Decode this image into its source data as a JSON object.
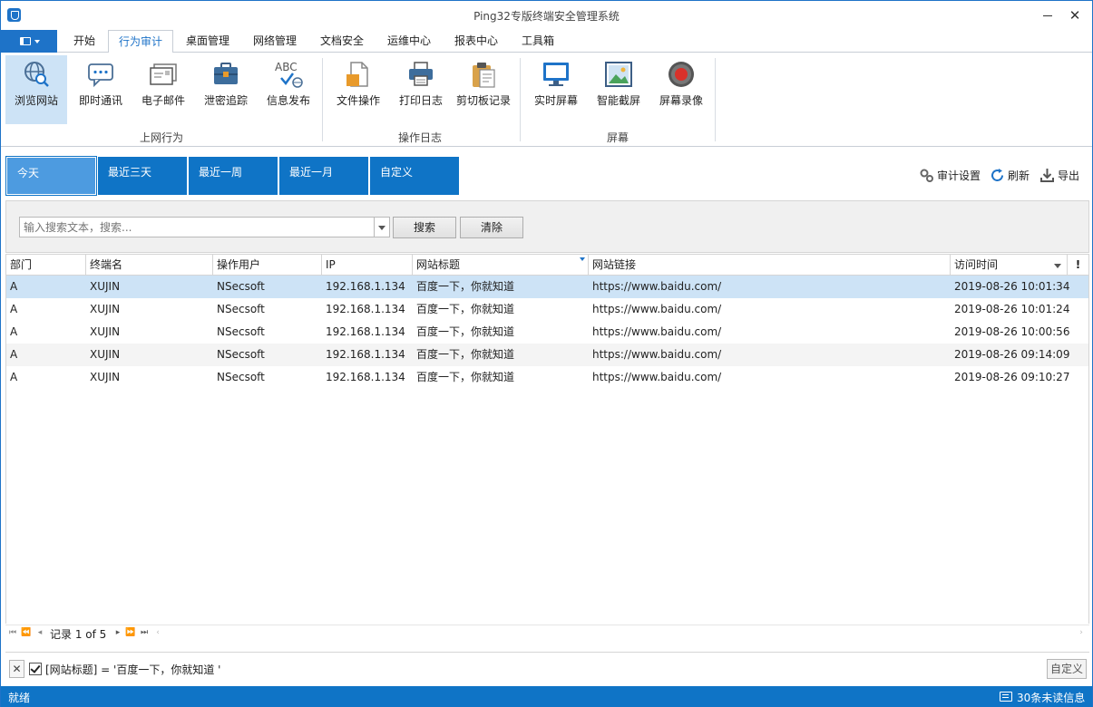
{
  "app": {
    "title": "Ping32专版终端安全管理系统"
  },
  "tabs": [
    {
      "label": "开始"
    },
    {
      "label": "行为审计"
    },
    {
      "label": "桌面管理"
    },
    {
      "label": "网络管理"
    },
    {
      "label": "文档安全"
    },
    {
      "label": "运维中心"
    },
    {
      "label": "报表中心"
    },
    {
      "label": "工具箱"
    }
  ],
  "active_tab": "行为审计",
  "ribbon": {
    "groups": [
      {
        "label": "上网行为"
      },
      {
        "label": "操作日志"
      },
      {
        "label": "屏幕"
      }
    ],
    "buttons": [
      {
        "label": "浏览网站",
        "icon": "globe-search-icon"
      },
      {
        "label": "即时通讯",
        "icon": "chat-bubble-icon"
      },
      {
        "label": "电子邮件",
        "icon": "email-icon"
      },
      {
        "label": "泄密追踪",
        "icon": "briefcase-icon"
      },
      {
        "label": "信息发布",
        "icon": "abc-publish-icon",
        "icon_text": "ABC"
      },
      {
        "label": "文件操作",
        "icon": "file-icon"
      },
      {
        "label": "打印日志",
        "icon": "printer-icon"
      },
      {
        "label": "剪切板记录",
        "icon": "clipboard-icon"
      },
      {
        "label": "实时屏幕",
        "icon": "monitor-icon"
      },
      {
        "label": "智能截屏",
        "icon": "screenshot-image-icon"
      },
      {
        "label": "屏幕录像",
        "icon": "record-icon"
      }
    ]
  },
  "date_tabs": [
    {
      "label": "今天"
    },
    {
      "label": "最近三天"
    },
    {
      "label": "最近一周"
    },
    {
      "label": "最近一月"
    },
    {
      "label": "自定义"
    }
  ],
  "toolbar_right": {
    "audit_settings": "审计设置",
    "refresh": "刷新",
    "export": "导出"
  },
  "search": {
    "placeholder": "输入搜索文本，搜索...",
    "search_button": "搜索",
    "clear_button": "清除"
  },
  "grid": {
    "columns": [
      "部门",
      "终端名",
      "操作用户",
      "IP",
      "网站标题",
      "网站链接",
      "访问时间"
    ],
    "rows": [
      [
        "A",
        "XUJIN",
        "NSecsoft",
        "192.168.1.134",
        "百度一下，你就知道",
        "https://www.baidu.com/",
        "2019-08-26 10:01:34"
      ],
      [
        "A",
        "XUJIN",
        "NSecsoft",
        "192.168.1.134",
        "百度一下，你就知道",
        "https://www.baidu.com/",
        "2019-08-26 10:01:24"
      ],
      [
        "A",
        "XUJIN",
        "NSecsoft",
        "192.168.1.134",
        "百度一下，你就知道",
        "https://www.baidu.com/",
        "2019-08-26 10:00:56"
      ],
      [
        "A",
        "XUJIN",
        "NSecsoft",
        "192.168.1.134",
        "百度一下，你就知道",
        "https://www.baidu.com/",
        "2019-08-26 09:14:09"
      ],
      [
        "A",
        "XUJIN",
        "NSecsoft",
        "192.168.1.134",
        "百度一下，你就知道",
        "https://www.baidu.com/",
        "2019-08-26 09:10:27"
      ]
    ],
    "selected_row": 0
  },
  "navigator": {
    "text": "记录 1 of 5"
  },
  "filter_bar": {
    "checked": true,
    "expression": "[网站标题] = '百度一下，你就知道 '",
    "custom_button": "自定义"
  },
  "status": {
    "left": "就绪",
    "right": "30条未读信息"
  },
  "colors": {
    "accent": "#0f74c6",
    "selected_row": "#cde3f6"
  }
}
